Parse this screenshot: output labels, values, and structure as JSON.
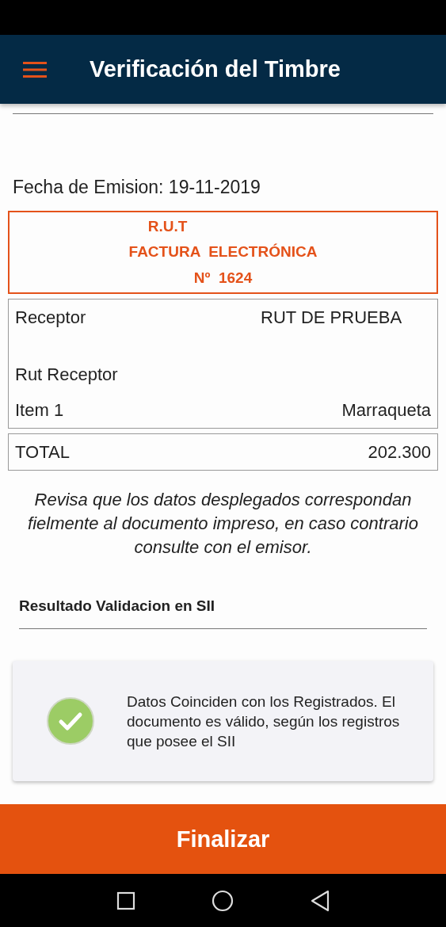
{
  "header": {
    "title": "Verificación del Timbre"
  },
  "issue_date": "Fecha de Emision: 19-11-2019",
  "document": {
    "rut": "R.U.T",
    "type": "FACTURA  ELECTRÓNICA",
    "number": "Nº  1624"
  },
  "details": [
    {
      "kind": "field",
      "label": "Receptor",
      "value": "RUT DE PRUEBA"
    },
    {
      "kind": "field",
      "label": "Rut Receptor"
    },
    {
      "kind": "item",
      "label": "Item 1",
      "value": "Marraqueta"
    }
  ],
  "total": {
    "label": "TOTAL",
    "value": "202.300"
  },
  "notice": "Revisa que los datos desplegados correspondan fielmente al documento impreso, en caso contrario consulte con el emisor.",
  "result": {
    "title": "Resultado Validacion en SII",
    "valid": true,
    "message": "Datos Coinciden con los Registrados. El documento es válido, según los registros que posee el SII"
  },
  "finish_button": "Finalizar"
}
